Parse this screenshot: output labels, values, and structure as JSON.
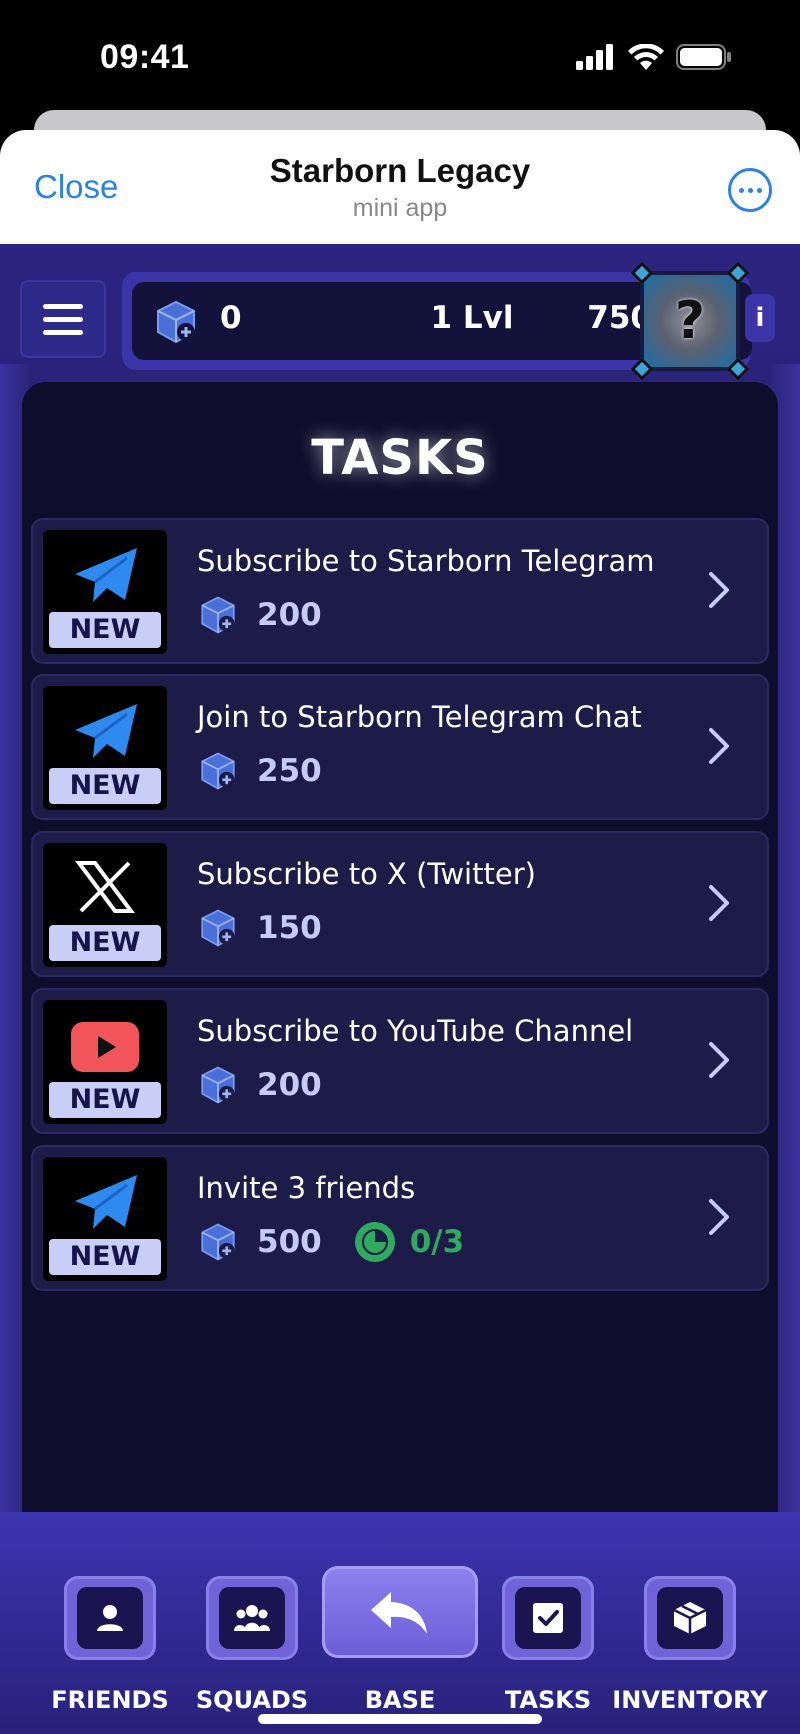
{
  "status_bar": {
    "time": "09:41"
  },
  "telegram_header": {
    "close_label": "Close",
    "title": "Starborn Legacy",
    "subtitle": "mini app"
  },
  "top_bar": {
    "points": "0",
    "level": "1 Lvl",
    "credits": "750",
    "avatar_text": "?",
    "info_label": "i"
  },
  "tasks": {
    "heading": "TASKS",
    "items": [
      {
        "title": "Subscribe to Starborn Telegram",
        "reward": "200",
        "badge": "NEW",
        "icon": "telegram-icon"
      },
      {
        "title": "Join to Starborn Telegram Chat",
        "reward": "250",
        "badge": "NEW",
        "icon": "telegram-icon"
      },
      {
        "title": "Subscribe to X (Twitter)",
        "reward": "150",
        "badge": "NEW",
        "icon": "x-icon"
      },
      {
        "title": "Subscribe to YouTube Channel",
        "reward": "200",
        "badge": "NEW",
        "icon": "youtube-icon"
      },
      {
        "title": "Invite 3 friends",
        "reward": "500",
        "badge": "NEW",
        "icon": "telegram-icon",
        "progress": "0/3"
      }
    ]
  },
  "bottom_nav": {
    "friends": "FRIENDS",
    "squads": "SQUADS",
    "base": "BASE",
    "tasks": "TASKS",
    "inventory": "INVENTORY"
  },
  "colors": {
    "accent_blue": "#2b82e4",
    "panel_bg": "#0f0d2c",
    "app_bg": "#221c66",
    "progress_green": "#2faa5e",
    "badge_bg": "#c8cef5"
  }
}
